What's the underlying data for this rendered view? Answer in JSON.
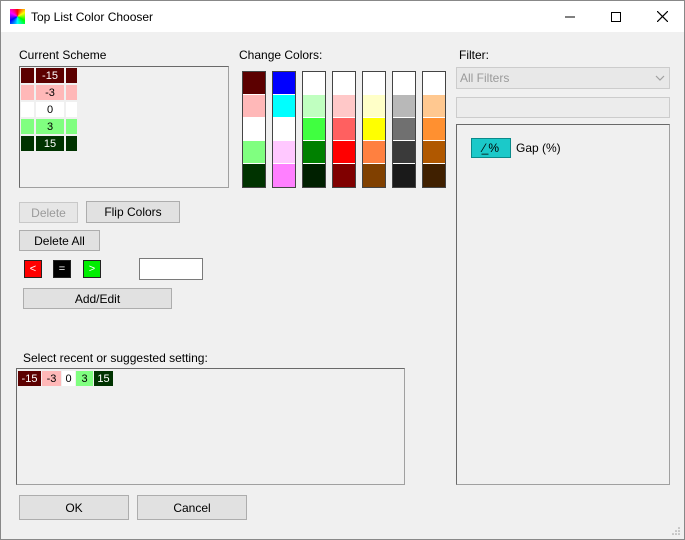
{
  "window": {
    "title": "Top List Color Chooser"
  },
  "current_scheme": {
    "label": "Current Scheme",
    "rows": [
      {
        "value": "-15",
        "color": "#5c0000",
        "text_color": "#ffffff"
      },
      {
        "value": "-3",
        "color": "#ffb8b8",
        "text_color": "#000000"
      },
      {
        "value": "0",
        "color": "#ffffff",
        "text_color": "#000000"
      },
      {
        "value": "3",
        "color": "#80ff80",
        "text_color": "#000000"
      },
      {
        "value": "15",
        "color": "#003300",
        "text_color": "#ffffff"
      }
    ]
  },
  "change_colors": {
    "label": "Change Colors:",
    "palettes": [
      [
        "#5c0000",
        "#ffb8b8",
        "#ffffff",
        "#80ff80",
        "#003300"
      ],
      [
        "#0000ff",
        "#00ffff",
        "#ffffff",
        "#ffc8ff",
        "#ff80ff"
      ],
      [
        "#ffffff",
        "#c0ffc0",
        "#40ff40",
        "#008000",
        "#002000"
      ],
      [
        "#ffffff",
        "#ffc8c8",
        "#ff6060",
        "#ff0000",
        "#800000"
      ],
      [
        "#ffffff",
        "#ffffc8",
        "#ffff00",
        "#ff8040",
        "#804000"
      ],
      [
        "#ffffff",
        "#b8b8b8",
        "#707070",
        "#3a3a3a",
        "#1a1a1a"
      ],
      [
        "#ffffff",
        "#ffc890",
        "#ff9030",
        "#b05800",
        "#402000"
      ]
    ]
  },
  "buttons": {
    "delete": "Delete",
    "flip_colors": "Flip Colors",
    "delete_all": "Delete All",
    "less_than": "<",
    "equals": "=",
    "greater_than": ">",
    "add_edit": "Add/Edit",
    "ok": "OK",
    "cancel": "Cancel"
  },
  "value_input": {
    "value": ""
  },
  "recent": {
    "label": "Select recent or suggested setting:",
    "items": [
      {
        "value": "-15",
        "color": "#5c0000",
        "text_color": "#ffffff"
      },
      {
        "value": "-3",
        "color": "#ffb8b8",
        "text_color": "#000000"
      },
      {
        "value": "0",
        "color": "#ffffff",
        "text_color": "#000000"
      },
      {
        "value": "3",
        "color": "#80ff80",
        "text_color": "#000000"
      },
      {
        "value": "15",
        "color": "#003300",
        "text_color": "#ffffff"
      }
    ]
  },
  "filter": {
    "label": "Filter:",
    "selected": "All Filters",
    "search_value": "",
    "items": [
      {
        "icon": "gap-percent-icon",
        "icon_text": "⁄̲ %",
        "label": "Gap (%)"
      }
    ]
  },
  "colors": {
    "op_less": "#ff0000",
    "op_equal": "#000000",
    "op_greater": "#00ee00",
    "filter_icon": "#1bc9c9"
  }
}
